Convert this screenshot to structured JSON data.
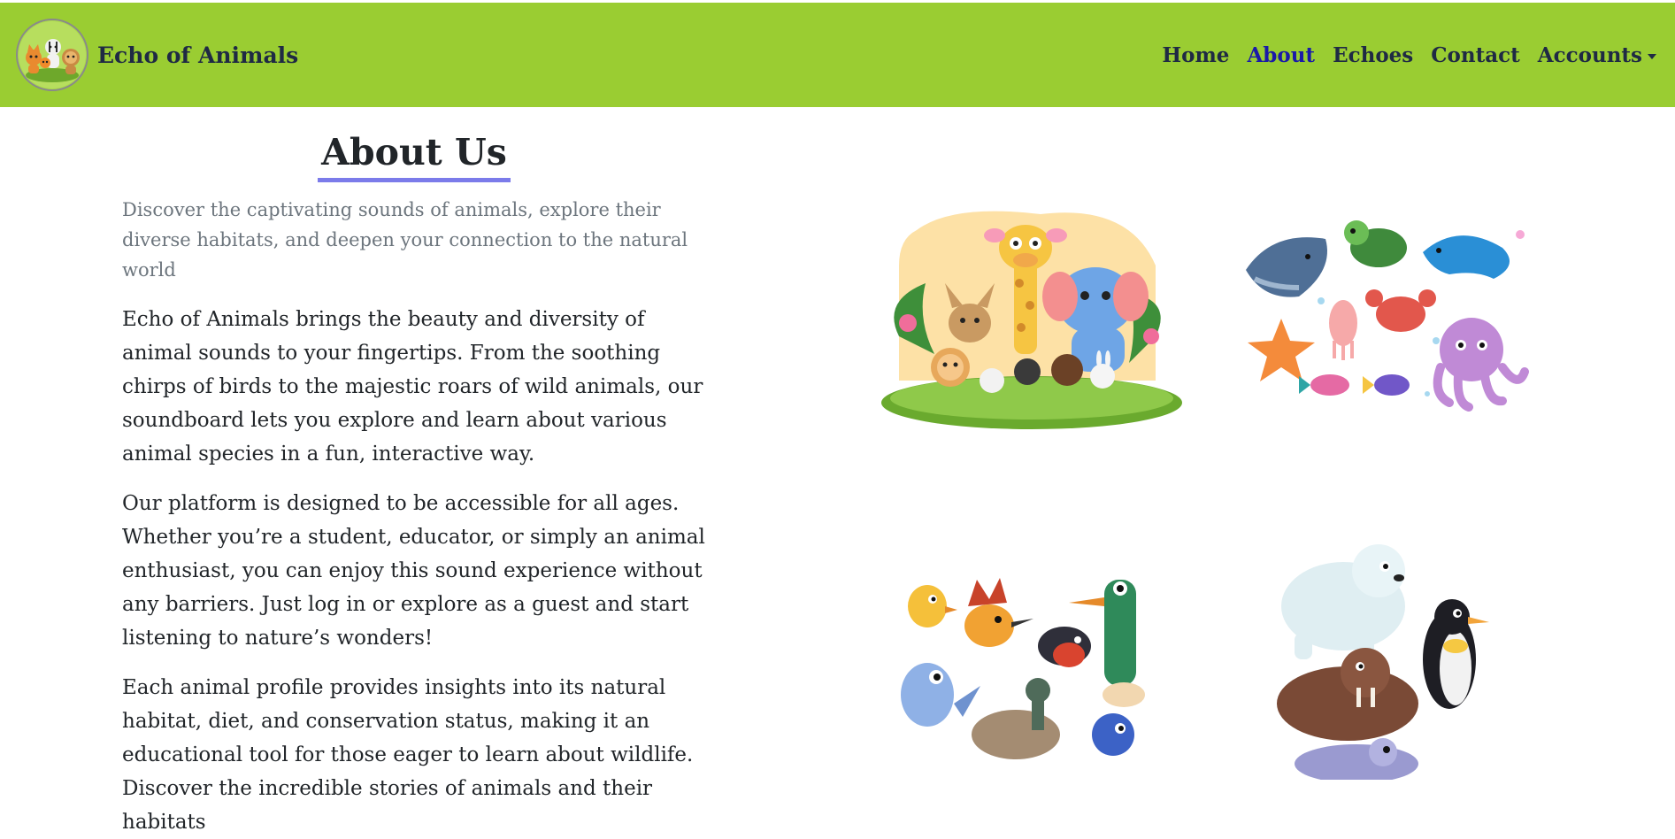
{
  "header": {
    "brand": "Echo of Animals",
    "logo_icon": "animals-logo-icon",
    "nav": [
      {
        "label": "Home",
        "active": false
      },
      {
        "label": "About",
        "active": true
      },
      {
        "label": "Echoes",
        "active": false
      },
      {
        "label": "Contact",
        "active": false
      },
      {
        "label": "Accounts",
        "active": false
      }
    ]
  },
  "colors": {
    "navbar": "#9acd32",
    "active_link": "#1a1aa8",
    "title_underline": "#7b7bea",
    "lead_text": "#6c757d"
  },
  "about": {
    "title": "About Us",
    "lead": "Discover the captivating sounds of animals, explore their diverse habitats, and deepen your connection to the natural world",
    "paragraphs": [
      "Echo of Animals brings the beauty and diversity of animal sounds to your fingertips. From the soothing chirps of birds to the majestic roars of wild animals, our soundboard lets you explore and learn about various animal species in a fun, interactive way.",
      "Our platform is designed to be accessible for all ages. Whether you’re a student, educator, or simply an animal enthusiast, you can enjoy this sound experience without any barriers. Just log in or explore as a guest and start listening to nature’s wonders!",
      "Each animal profile provides insights into its natural habitat, diet, and conservation status, making it an educational tool for those eager to learn about wildlife. Discover the incredible stories of animals and their habitats"
    ]
  },
  "gallery": [
    {
      "icon": "land-animals-illustration-icon"
    },
    {
      "icon": "sea-animals-illustration-icon"
    },
    {
      "icon": "birds-illustration-icon"
    },
    {
      "icon": "polar-animals-illustration-icon"
    }
  ]
}
